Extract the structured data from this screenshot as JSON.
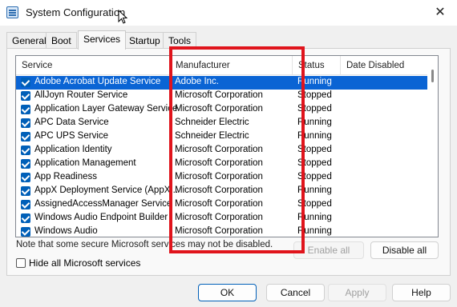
{
  "window": {
    "title": "System Configuration",
    "close_glyph": "✕"
  },
  "tabs": [
    {
      "label": "General"
    },
    {
      "label": "Boot"
    },
    {
      "label": "Services"
    },
    {
      "label": "Startup"
    },
    {
      "label": "Tools"
    }
  ],
  "active_tab": "Services",
  "columns": {
    "service": "Service",
    "manufacturer": "Manufacturer",
    "status": "Status",
    "date_disabled": "Date Disabled"
  },
  "rows": [
    {
      "service": "Adobe Acrobat Update Service",
      "manufacturer": "Adobe Inc.",
      "status": "Running",
      "checked": true,
      "selected": true
    },
    {
      "service": "AllJoyn Router Service",
      "manufacturer": "Microsoft Corporation",
      "status": "Stopped",
      "checked": true
    },
    {
      "service": "Application Layer Gateway Service",
      "manufacturer": "Microsoft Corporation",
      "status": "Stopped",
      "checked": true
    },
    {
      "service": "APC Data Service",
      "manufacturer": "Schneider Electric",
      "status": "Running",
      "checked": true
    },
    {
      "service": "APC UPS Service",
      "manufacturer": "Schneider Electric",
      "status": "Running",
      "checked": true
    },
    {
      "service": "Application Identity",
      "manufacturer": "Microsoft Corporation",
      "status": "Stopped",
      "checked": true
    },
    {
      "service": "Application Management",
      "manufacturer": "Microsoft Corporation",
      "status": "Stopped",
      "checked": true
    },
    {
      "service": "App Readiness",
      "manufacturer": "Microsoft Corporation",
      "status": "Stopped",
      "checked": true
    },
    {
      "service": "AppX Deployment Service (AppX...",
      "manufacturer": "Microsoft Corporation",
      "status": "Running",
      "checked": true
    },
    {
      "service": "AssignedAccessManager Service",
      "manufacturer": "Microsoft Corporation",
      "status": "Stopped",
      "checked": true
    },
    {
      "service": "Windows Audio Endpoint Builder",
      "manufacturer": "Microsoft Corporation",
      "status": "Running",
      "checked": true
    },
    {
      "service": "Windows Audio",
      "manufacturer": "Microsoft Corporation",
      "status": "Running",
      "checked": true
    }
  ],
  "note": "Note that some secure Microsoft services may not be disabled.",
  "buttons": {
    "enable_all": "Enable all",
    "disable_all": "Disable all",
    "ok": "OK",
    "cancel": "Cancel",
    "apply": "Apply",
    "help": "Help"
  },
  "hide_ms_services": {
    "label": "Hide all Microsoft services",
    "checked": false
  },
  "colors": {
    "selection": "#0a64d4",
    "checkbox": "#005fb8",
    "highlight_box": "#e0141c"
  }
}
